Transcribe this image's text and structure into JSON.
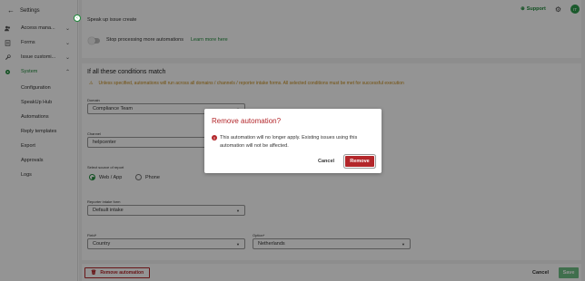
{
  "sidebar": {
    "header": "Settings",
    "items": [
      {
        "label": "Access mana...",
        "icon": "people-icon"
      },
      {
        "label": "Forms",
        "icon": "forms-icon"
      },
      {
        "label": "Issue customi...",
        "icon": "wrench-icon"
      },
      {
        "label": "System",
        "icon": "gear-icon"
      }
    ],
    "sub_items": [
      "Configuration",
      "SpeakUp Hub",
      "Automations",
      "Reply templates",
      "Export",
      "Approvals",
      "Logs"
    ]
  },
  "topbar": {
    "support": "Support",
    "avatar": "IT"
  },
  "automation": {
    "action_text": "Speak up issue create",
    "stop_processing": "Stop processing more automations",
    "learn_more": "Learn more here"
  },
  "conditions": {
    "heading": "If all these conditions match",
    "warning": "Unless specified, automations will run across all domains / channels / reporter intake forms. All selected conditions must be met for successful execution",
    "domain_label": "Domain",
    "domain_value": "Compliance Team",
    "channel_label": "Channel",
    "channel_value": "helpcenter",
    "source_label": "Select source of report",
    "source_options": [
      "Web / App",
      "Phone"
    ],
    "intake_label": "Reporter intake form",
    "intake_value": "Default intake",
    "field_label": "Field*",
    "field_value": "Country",
    "option_label": "Option*",
    "option_value": "Netherlands"
  },
  "footer": {
    "remove": "Remove automation",
    "cancel": "Cancel",
    "save": "Save"
  },
  "modal": {
    "title": "Remove automation?",
    "message": "This automation will no longer apply. Existing issues using this automation will not be affected.",
    "cancel": "Cancel",
    "confirm": "Remove"
  },
  "colors": {
    "accent": "#1e8a3a",
    "danger": "#b3262a",
    "warning": "#c78a15"
  }
}
